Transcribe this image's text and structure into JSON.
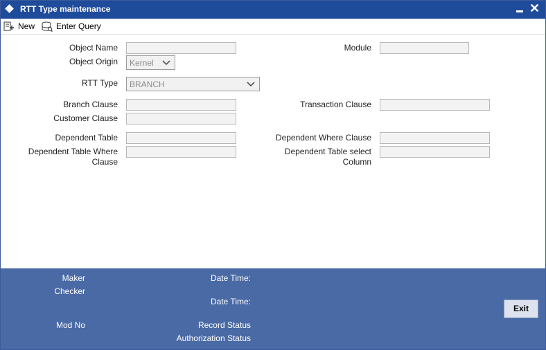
{
  "window": {
    "title": "RTT Type maintenance"
  },
  "toolbar": {
    "new_label": "New",
    "enter_query_label": "Enter Query"
  },
  "form": {
    "object_name_label": "Object Name",
    "object_name_value": "",
    "module_label": "Module",
    "module_value": "",
    "object_origin_label": "Object Origin",
    "object_origin_value": "Kernel",
    "rtt_type_label": "RTT Type",
    "rtt_type_value": "BRANCH",
    "branch_clause_label": "Branch Clause",
    "branch_clause_value": "",
    "transaction_clause_label": "Transaction Clause",
    "transaction_clause_value": "",
    "customer_clause_label": "Customer Clause",
    "customer_clause_value": "",
    "dependent_table_label": "Dependent Table",
    "dependent_table_value": "",
    "dependent_where_clause_label": "Dependent Where Clause",
    "dependent_where_clause_value": "",
    "dependent_table_where_clause_label_1": "Dependent Table Where",
    "dependent_table_where_clause_label_2": "Clause",
    "dependent_table_where_clause_value": "",
    "dependent_table_select_column_label_1": "Dependent Table select",
    "dependent_table_select_column_label_2": "Column",
    "dependent_table_select_column_value": ""
  },
  "footer": {
    "maker_label": "Maker",
    "checker_label": "Checker",
    "date_time_label_1": "Date Time:",
    "date_time_label_2": "Date Time:",
    "mod_no_label": "Mod No",
    "record_status_label": "Record Status",
    "authorization_status_label": "Authorization Status",
    "exit_label": "Exit"
  },
  "colors": {
    "title_bar": "#1f4b9b",
    "footer": "#4a6aa5",
    "field_bg": "#f3f3f3"
  }
}
